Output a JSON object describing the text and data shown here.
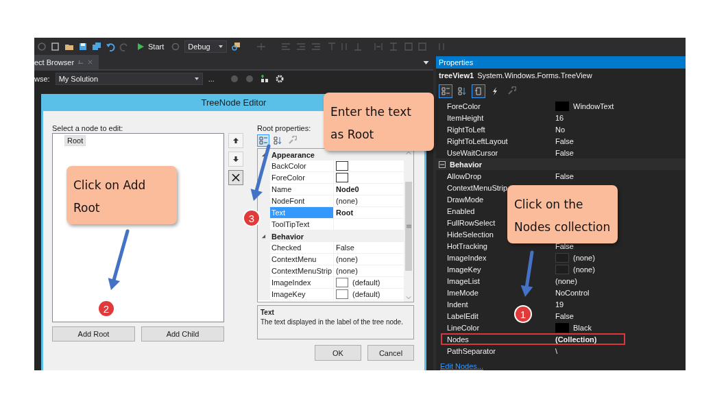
{
  "ide": {
    "toolbar": {
      "start": "Start",
      "configuration": "Debug"
    },
    "browser_tab": "ect Browser",
    "browse_label": "wse:",
    "browse_scope": "My Solution",
    "browse_more": "..."
  },
  "dialog": {
    "title": "TreeNode Editor",
    "tree_label": "Select a node to edit:",
    "nodes": [
      {
        "label": "Root",
        "selected": true
      }
    ],
    "add_root": "Add Root",
    "add_child": "Add Child",
    "props_label": "Root properties:",
    "categories": [
      {
        "name": "Appearance",
        "expanded": true,
        "rows": [
          {
            "name": "BackColor",
            "kind": "color",
            "color": "#ffffff",
            "selected": false
          },
          {
            "name": "ForeColor",
            "kind": "color",
            "color": "#ffffff",
            "selected": false
          },
          {
            "name": "Name",
            "kind": "text",
            "value": "Node0",
            "bold": true,
            "selected": false
          },
          {
            "name": "NodeFont",
            "kind": "text",
            "value": "(none)",
            "bold": false,
            "selected": false
          },
          {
            "name": "Text",
            "kind": "text",
            "value": "Root",
            "bold": true,
            "selected": true
          },
          {
            "name": "ToolTipText",
            "kind": "text",
            "selected": false
          }
        ]
      },
      {
        "name": "Behavior",
        "expanded": true,
        "rows": [
          {
            "name": "Checked",
            "kind": "text",
            "value": "False",
            "bold": false,
            "selected": false
          },
          {
            "name": "ContextMenu",
            "kind": "text",
            "value": "(none)",
            "bold": false,
            "selected": false
          },
          {
            "name": "ContextMenuStrip",
            "kind": "text",
            "value": "(none)",
            "bold": false,
            "selected": false
          },
          {
            "name": "ImageIndex",
            "kind": "image",
            "value": "(default)",
            "bold": false,
            "selected": false
          },
          {
            "name": "ImageKey",
            "kind": "image",
            "value": "(default)",
            "bold": false,
            "selected": false
          }
        ]
      }
    ],
    "description": {
      "title": "Text",
      "text": "The text displayed in the label of the tree node."
    },
    "ok": "OK",
    "cancel": "Cancel"
  },
  "properties": {
    "title": "Properties",
    "object_name": "treeView1",
    "object_type": "System.Windows.Forms.TreeView",
    "groups": [
      {
        "rows": [
          {
            "name": "ForeColor",
            "kind": "color",
            "color": "#000000",
            "value": "WindowText",
            "bold": false,
            "outlined": false
          },
          {
            "name": "ItemHeight",
            "kind": "text",
            "value": "16",
            "bold": false,
            "outlined": false
          },
          {
            "name": "RightToLeft",
            "kind": "text",
            "value": "No",
            "bold": false,
            "outlined": false
          },
          {
            "name": "RightToLeftLayout",
            "kind": "text",
            "value": "False",
            "bold": false,
            "outlined": false
          },
          {
            "name": "UseWaitCursor",
            "kind": "text",
            "value": "False",
            "bold": false,
            "outlined": false
          }
        ]
      },
      {
        "name": "Behavior",
        "expanded": true,
        "rows": [
          {
            "name": "AllowDrop",
            "kind": "text",
            "value": "False",
            "bold": false,
            "outlined": false
          },
          {
            "name": "ContextMenuStrip",
            "kind": "text",
            "outlined": false
          },
          {
            "name": "DrawMode",
            "kind": "text",
            "outlined": false
          },
          {
            "name": "Enabled",
            "kind": "text",
            "outlined": false
          },
          {
            "name": "FullRowSelect",
            "kind": "text",
            "outlined": false
          },
          {
            "name": "HideSelection",
            "kind": "text",
            "outlined": false
          },
          {
            "name": "HotTracking",
            "kind": "text",
            "value": "False",
            "bold": false,
            "outlined": false
          },
          {
            "name": "ImageIndex",
            "kind": "image",
            "value": "(none)",
            "bold": false,
            "outlined": false
          },
          {
            "name": "ImageKey",
            "kind": "image",
            "value": "(none)",
            "bold": false,
            "outlined": false
          },
          {
            "name": "ImageList",
            "kind": "text",
            "value": "(none)",
            "bold": false,
            "outlined": false
          },
          {
            "name": "ImeMode",
            "kind": "text",
            "value": "NoControl",
            "bold": false,
            "outlined": false
          },
          {
            "name": "Indent",
            "kind": "text",
            "value": "19",
            "bold": false,
            "outlined": false
          },
          {
            "name": "LabelEdit",
            "kind": "text",
            "value": "False",
            "bold": false,
            "outlined": false
          },
          {
            "name": "LineColor",
            "kind": "color",
            "color": "#000000",
            "value": "Black",
            "bold": false,
            "outlined": false
          },
          {
            "name": "Nodes",
            "kind": "text",
            "value": "(Collection)",
            "bold": true,
            "outlined": true
          },
          {
            "name": "PathSeparator",
            "kind": "text",
            "value": "\\",
            "bold": false,
            "outlined": false
          }
        ]
      }
    ],
    "link": "Edit Nodes..."
  },
  "callouts": [
    {
      "lines": [
        "Enter the text",
        "as Root"
      ]
    },
    {
      "lines": [
        "Click on Add",
        "Root"
      ]
    },
    {
      "lines": [
        "Click on the",
        "Nodes collection"
      ]
    }
  ],
  "markers": [
    {
      "number": "3"
    },
    {
      "number": "2"
    },
    {
      "number": "1"
    }
  ]
}
